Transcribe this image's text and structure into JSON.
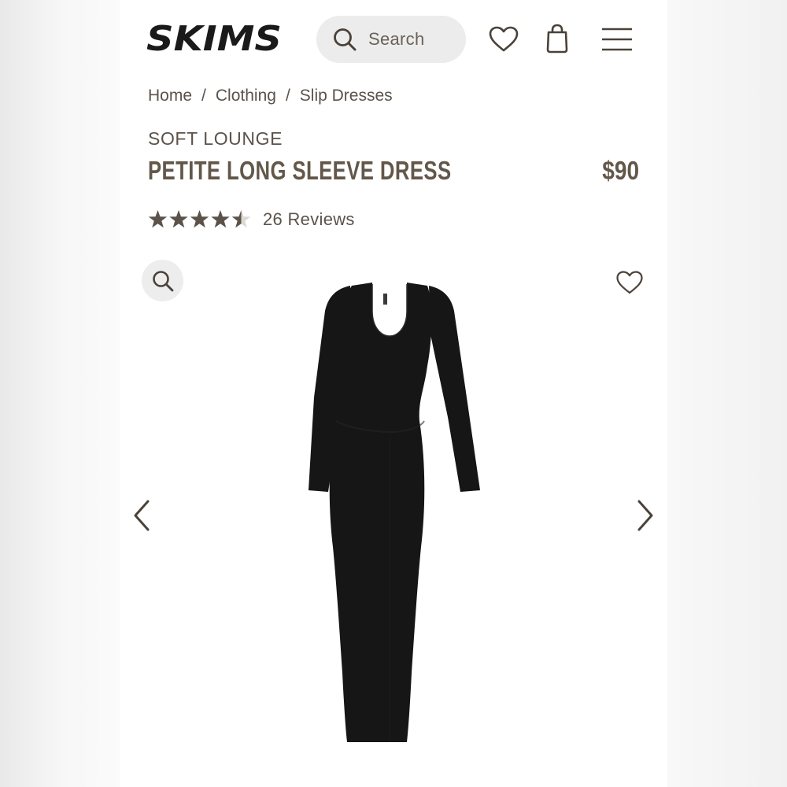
{
  "header": {
    "logo_text": "SKIMS",
    "search_placeholder": "Search"
  },
  "breadcrumb": [
    "Home",
    "Clothing",
    "Slip Dresses"
  ],
  "product": {
    "collection": "SOFT LOUNGE",
    "title": "PETITE LONG SLEEVE DRESS",
    "price": "$90",
    "rating": 4.6,
    "reviews": "26 Reviews",
    "image_description": "black long sleeve scoop neck maxi dress"
  },
  "colors": {
    "text": "#5b534a",
    "title": "#625749",
    "search_bg": "#ececec",
    "star": "#5b534a",
    "dress": "#161616"
  },
  "icons": [
    "search-icon",
    "heart-icon",
    "bag-icon",
    "menu-icon",
    "zoom-icon",
    "favorite-icon",
    "chevron-left-icon",
    "chevron-right-icon",
    "star-icon"
  ]
}
